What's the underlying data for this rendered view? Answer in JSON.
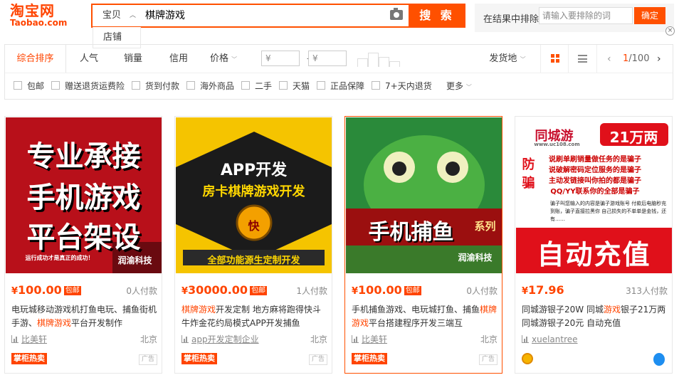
{
  "header": {
    "logo_cn": "淘宝网",
    "logo_en": "Taobao.com",
    "search_type": "宝贝",
    "search_query": "棋牌游戏",
    "search_button": "搜 索",
    "search_type_option": "店铺",
    "exclude_label": "在结果中排除",
    "exclude_placeholder": "请输入要排除的词",
    "exclude_button": "确定",
    "close_glyph": "×"
  },
  "sortbar": {
    "sorts": [
      "综合排序",
      "人气",
      "销量",
      "信用",
      "价格"
    ],
    "price_min_placeholder": "¥",
    "price_max_placeholder": "¥",
    "price_dash": "-",
    "ship_from": "发货地",
    "page_current": "1",
    "page_total": "/100",
    "prev_glyph": "‹",
    "next_glyph": "›"
  },
  "filters": {
    "items": [
      "包邮",
      "赠送退货运费险",
      "货到付款",
      "海外商品",
      "二手",
      "天猫",
      "正品保障",
      "7+天内退货"
    ],
    "more": "更多"
  },
  "products": [
    {
      "currency": "¥",
      "price": "100.00",
      "shipping_tag": "包邮",
      "deals": "0人付款",
      "title_parts": [
        "电玩城移动游戏机打鱼电玩、捕鱼街机手游、",
        "棋牌游戏",
        "平台开发制作"
      ],
      "shop": "比美轩",
      "location": "北京",
      "badge": "掌柜热卖",
      "ad": "广告",
      "image_lines": [
        "专业承接",
        "手机游戏",
        "平台架设"
      ],
      "image_footer": "运行成功才是真正的成功！",
      "image_logo": "润渝科技"
    },
    {
      "currency": "¥",
      "price": "30000.00",
      "shipping_tag": "包邮",
      "deals": "1人付款",
      "title_parts": [
        "",
        "棋牌游戏",
        "开发定制 地方麻将跑得快斗牛炸金花约局模式APP开发捕鱼"
      ],
      "shop": "app开发定制企业",
      "location": "北京",
      "badge": "掌柜热卖",
      "ad": "广告",
      "image_lines": [
        "APP开发",
        "房卡棋牌游戏开发"
      ],
      "image_coin": "快",
      "image_footer": "全部功能源生定制开发"
    },
    {
      "currency": "¥",
      "price": "100.00",
      "shipping_tag": "包邮",
      "deals": "0人付款",
      "title_parts": [
        "手机捕鱼游戏、电玩城打鱼、捕鱼",
        "棋牌游戏",
        "平台搭建程序开发三端互"
      ],
      "shop": "比美轩",
      "location": "北京",
      "badge": "掌柜热卖",
      "ad": "广告",
      "image_banner": "手机捕鱼",
      "image_banner_sub": "系列",
      "image_logo": "润渝科技"
    },
    {
      "currency": "¥",
      "price": "17.96",
      "shipping_tag": "",
      "deals": "313人付款",
      "title_parts": [
        "同城游银子20W 同城",
        "游戏",
        "银子21万两 同城游银子20元 自动充值"
      ],
      "shop": "xuelantree",
      "location": "",
      "badge": "",
      "ad": "",
      "image_brand": "同城游",
      "image_brand_url": "www.uc108.com",
      "image_amount": "21万两",
      "image_side": [
        "防",
        "骗"
      ],
      "image_warnings": [
        "说刷单刷销量做任务的是骗子",
        "说破解密码定位服务的是骗子",
        "主动发链接叫你拍的都是骗子",
        "QQ/YY联系你的全部是骗子"
      ],
      "image_note": "骗子叫您输入的内容是骗子游戏账号 付款后电脑秒充到账，骗子直接拉黑你 自己损失的不单单是金钱，还有……",
      "image_bottom": "自动充值"
    }
  ],
  "colors": {
    "accent": "#ff4400",
    "search_border": "#ff5000"
  }
}
